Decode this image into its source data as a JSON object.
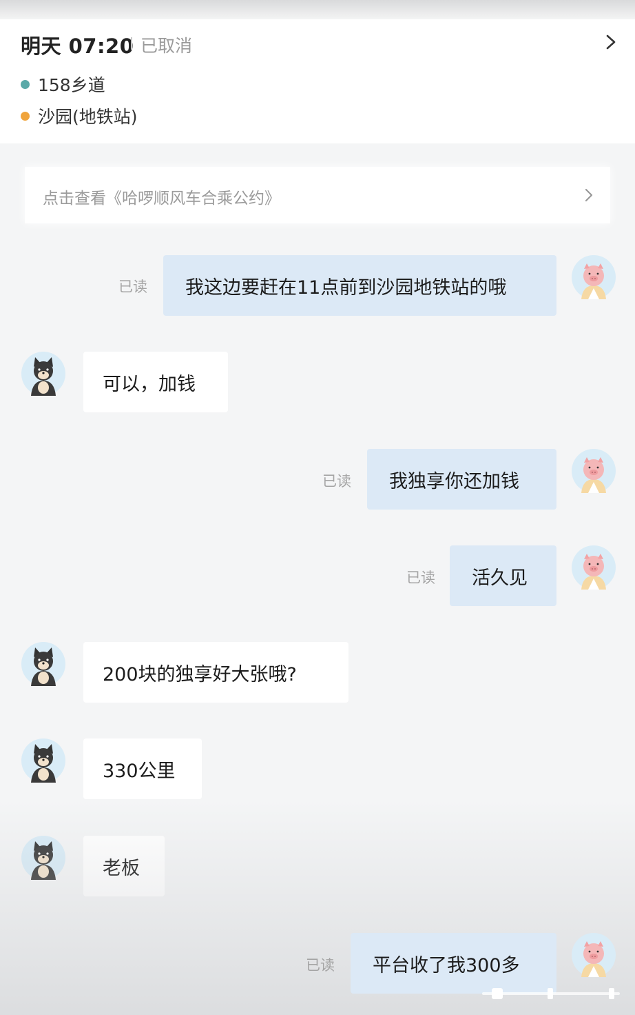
{
  "trip": {
    "time": "明天 07:20",
    "status": "已取消",
    "start_location": "158乡道",
    "end_location": "沙园(地铁站)"
  },
  "convention_link": "点击查看《哈啰顺风车合乘公约》",
  "read_label": "已读",
  "messages": [
    {
      "from": "me",
      "text": "我这边要赶在11点前到沙园地铁站的哦",
      "read": "已读"
    },
    {
      "from": "driver",
      "text": "可以，加钱"
    },
    {
      "from": "me",
      "text": "我独享你还加钱",
      "read": "已读"
    },
    {
      "from": "me",
      "text": "活久见",
      "read": "已读"
    },
    {
      "from": "driver",
      "text": "200块的独享好大张哦?"
    },
    {
      "from": "driver",
      "text": "330公里"
    },
    {
      "from": "driver",
      "text": "老板"
    },
    {
      "from": "me",
      "text": "平台收了我300多",
      "read": "已读"
    }
  ],
  "colors": {
    "start_dot": "#5aa9a8",
    "end_dot": "#f0a43c",
    "sent_bubble": "#dce9f6",
    "received_bubble": "#ffffff"
  },
  "icons": {
    "trip_chevron": "chevron-right-icon",
    "convention_chevron": "chevron-right-icon",
    "my_avatar": "pig-avatar-icon",
    "driver_avatar": "shiba-dog-avatar-icon"
  }
}
